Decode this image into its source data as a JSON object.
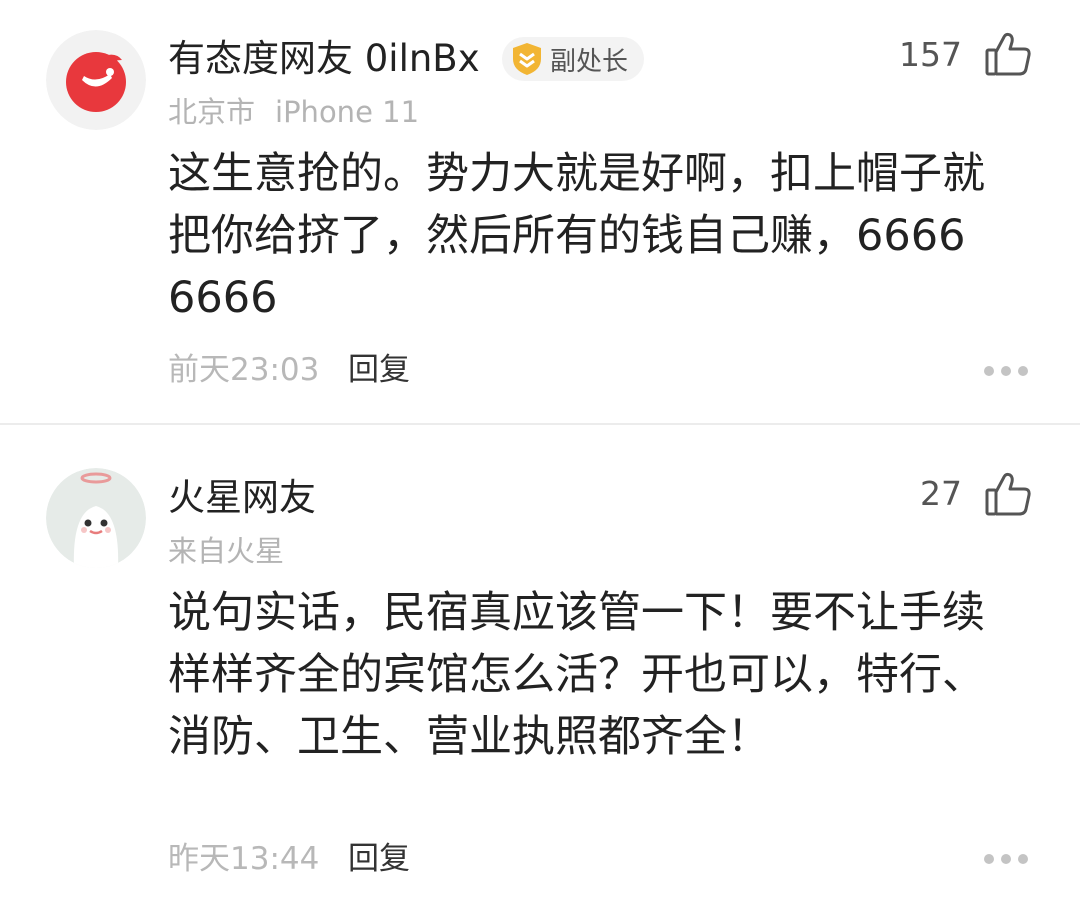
{
  "comments": [
    {
      "username": "有态度网友 0ilnBx",
      "badge": {
        "label": "副处长",
        "icon": "shield-badge-icon",
        "color": "#f2b533"
      },
      "location": "北京市",
      "device": "iPhone 11",
      "text": "这生意抢的。势力大就是好啊，扣上帽子就把你给挤了，然后所有的钱自己赚，66666666",
      "time": "前天23:03",
      "reply_label": "回复",
      "likes": "157",
      "avatar": {
        "icon": "netease-logo-icon",
        "color": "#e8383d"
      }
    },
    {
      "username": "火星网友",
      "location": "来自火星",
      "text": "说句实话，民宿真应该管一下！要不让手续样样齐全的宾馆怎么活？开也可以，特行、消防、卫生、营业执照都齐全！",
      "time": "昨天13:44",
      "reply_label": "回复",
      "likes": "27",
      "avatar": {
        "icon": "mars-alien-icon",
        "color": "#e6ebe8"
      }
    }
  ]
}
